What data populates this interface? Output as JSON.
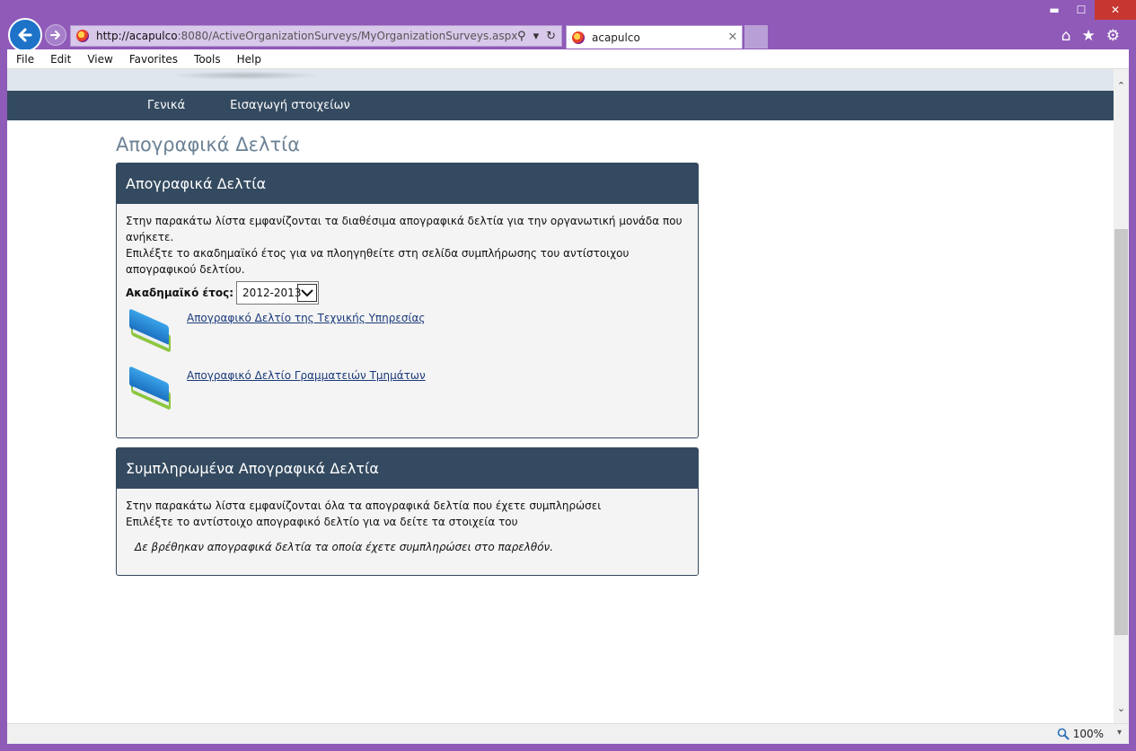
{
  "browser": {
    "url_host": "http://acapulco",
    "url_rest": ":8080/ActiveOrganizationSurveys/MyOrganizationSurveys.aspx",
    "tab_title": "acapulco",
    "zoom": "100%",
    "search_glyph": "⚲",
    "dropdown_glyph": "▾",
    "refresh_glyph": "↻",
    "tab_close_glyph": "✕",
    "minimize_glyph": "▬",
    "maximize_glyph": "☐",
    "close_glyph": "✕",
    "home_glyph": "⌂",
    "favorites_glyph": "★",
    "settings_glyph": "⚙",
    "scroll_up_glyph": "⌃",
    "scroll_down_glyph": "⌄"
  },
  "menu": {
    "items": [
      "File",
      "Edit",
      "View",
      "Favorites",
      "Tools",
      "Help"
    ]
  },
  "nav": {
    "items": [
      "Γενικά",
      "Εισαγωγή στοιχείων"
    ]
  },
  "page": {
    "title": "Απογραφικά Δελτία"
  },
  "panel_available": {
    "header": "Απογραφικά Δελτία",
    "intro_line1": "Στην παρακάτω λίστα εμφανίζονται τα διαθέσιμα απογραφικά δελτία για την οργανωτική μονάδα που ανήκετε.",
    "intro_line2": "Επιλέξτε το ακαδημαϊκό έτος για να πλοηγηθείτε στη σελίδα συμπλήρωσης του αντίστοιχου απογραφικού δελτίου.",
    "year_label": "Ακαδημαϊκό έτος:",
    "year_value": "2012-2013",
    "surveys": [
      "Απογραφικό Δελτίο της Τεχνικής Υπηρεσίας",
      "Απογραφικό Δελτίο Γραμματειών Τμημάτων"
    ]
  },
  "panel_completed": {
    "header": "Συμπληρωμένα Απογραφικά Δελτία",
    "intro_line1": "Στην παρακάτω λίστα εμφανίζονται όλα τα απογραφικά δελτία που έχετε συμπληρώσει",
    "intro_line2": "Επιλέξτε το αντίστοιχο απογραφικό δελτίο για να δείτε τα στοιχεία του",
    "empty_message": "Δε βρέθηκαν απογραφικά δελτία τα οποία έχετε συμπληρώσει στο παρελθόν."
  },
  "colors": {
    "chrome": "#8f5ab8",
    "nav_bg": "#344a60",
    "title_color": "#6b8296",
    "link_color": "#1a3a7a"
  }
}
